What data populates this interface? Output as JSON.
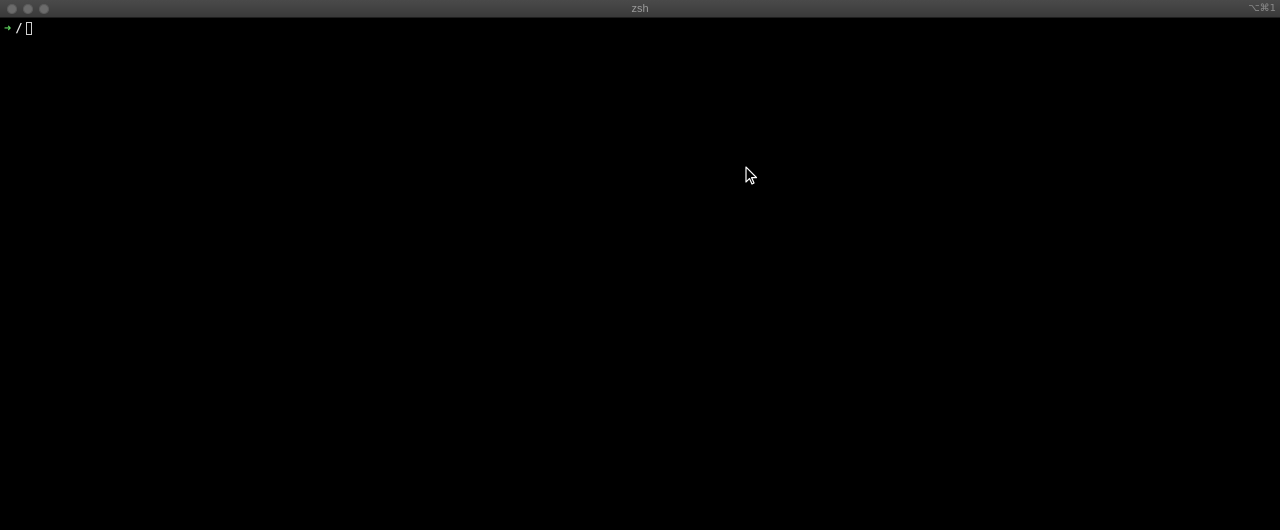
{
  "window": {
    "title": "zsh",
    "shortcut": "⌥⌘1"
  },
  "terminal": {
    "prompt_symbol": "➜",
    "cwd": "/",
    "input_text": ""
  },
  "colors": {
    "prompt_arrow": "#5fd35f",
    "background": "#000000",
    "titlebar": "#3c3c3c"
  },
  "icons": {
    "mouse": "arrow-pointer-icon"
  }
}
